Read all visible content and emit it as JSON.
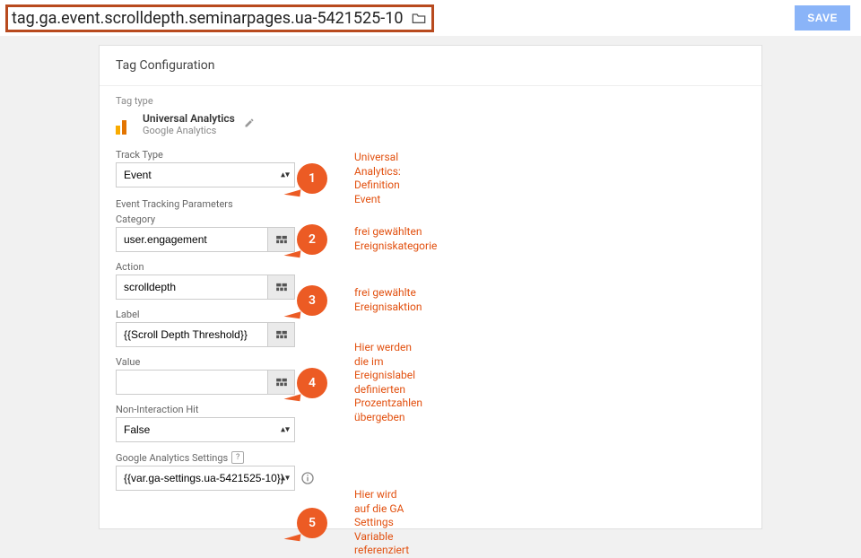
{
  "header": {
    "tag_name": "tag.ga.event.scrolldepth.seminarpages.ua-5421525-10",
    "save_label": "SAVE"
  },
  "card": {
    "title": "Tag Configuration",
    "tag_type_label": "Tag type",
    "type_name": "Universal Analytics",
    "type_sub": "Google Analytics"
  },
  "form": {
    "track_type_label": "Track Type",
    "track_type_value": "Event",
    "etp_label": "Event Tracking Parameters",
    "category_label": "Category",
    "category_value": "user.engagement",
    "action_label": "Action",
    "action_value": "scrolldepth",
    "label_label": "Label",
    "label_value": "{{Scroll Depth Threshold}}",
    "value_label": "Value",
    "value_value": "",
    "nih_label": "Non-Interaction Hit",
    "nih_value": "False",
    "gas_label": "Google Analytics Settings",
    "gas_help": "?",
    "gas_value": "{{var.ga-settings.ua-5421525-10}}"
  },
  "callouts": {
    "1": {
      "num": "1",
      "text": "Universal Analytics: Definition Event"
    },
    "2": {
      "num": "2",
      "text": "frei gewählten Ereigniskategorie"
    },
    "3": {
      "num": "3",
      "text": "frei gewählte Ereignisaktion"
    },
    "4": {
      "num": "4",
      "text": "Hier werden die im Ereignislabel definierten Prozentzahlen übergeben"
    },
    "5": {
      "num": "5",
      "text": "Hier wird auf die GA Settings Variable referenziert"
    }
  }
}
